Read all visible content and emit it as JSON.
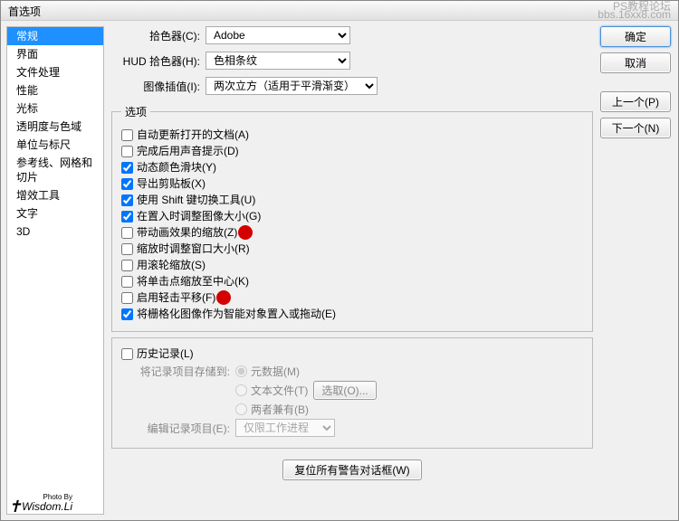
{
  "title": "首选项",
  "watermark": {
    "l1": "PS教程论坛",
    "l2": "bbs.16xx8.com"
  },
  "sidebar": {
    "items": [
      {
        "label": "常规",
        "active": true
      },
      {
        "label": "界面"
      },
      {
        "label": "文件处理"
      },
      {
        "label": "性能"
      },
      {
        "label": "光标"
      },
      {
        "label": "透明度与色域"
      },
      {
        "label": "单位与标尺"
      },
      {
        "label": "参考线、网格和切片"
      },
      {
        "label": "增效工具"
      },
      {
        "label": "文字"
      },
      {
        "label": "3D"
      }
    ]
  },
  "buttons": {
    "ok": "确定",
    "cancel": "取消",
    "prev": "上一个(P)",
    "next": "下一个(N)"
  },
  "pickers": {
    "colorPickerLabel": "拾色器(C):",
    "colorPickerValue": "Adobe",
    "hudLabel": "HUD 拾色器(H):",
    "hudValue": "色相条纹",
    "interpLabel": "图像插值(I):",
    "interpValue": "两次立方（适用于平滑渐变）"
  },
  "optionsLegend": "选项",
  "options": [
    {
      "label": "自动更新打开的文档(A)",
      "checked": false
    },
    {
      "label": "完成后用声音提示(D)",
      "checked": false
    },
    {
      "label": "动态颜色滑块(Y)",
      "checked": true
    },
    {
      "label": "导出剪贴板(X)",
      "checked": true
    },
    {
      "label": "使用 Shift 键切换工具(U)",
      "checked": true
    },
    {
      "label": "在置入时调整图像大小(G)",
      "checked": true
    },
    {
      "label": "带动画效果的缩放(Z)",
      "checked": false,
      "dot": true
    },
    {
      "label": "缩放时调整窗口大小(R)",
      "checked": false
    },
    {
      "label": "用滚轮缩放(S)",
      "checked": false
    },
    {
      "label": "将单击点缩放至中心(K)",
      "checked": false
    },
    {
      "label": "启用轻击平移(F)",
      "checked": false,
      "dot": true
    },
    {
      "label": "将栅格化图像作为智能对象置入或拖动(E)",
      "checked": true
    }
  ],
  "history": {
    "checkboxLabel": "历史记录(L)",
    "saveToLabel": "将记录项目存储到:",
    "radios": {
      "meta": "元数据(M)",
      "text": "文本文件(T)",
      "both": "两者兼有(B)"
    },
    "chooseBtn": "选取(O)...",
    "editLabel": "编辑记录项目(E):",
    "editValue": "仅限工作进程"
  },
  "resetBtn": "复位所有警告对话框(W)",
  "signature": {
    "photoBy": "Photo By",
    "name": "Wisdom.Li"
  }
}
